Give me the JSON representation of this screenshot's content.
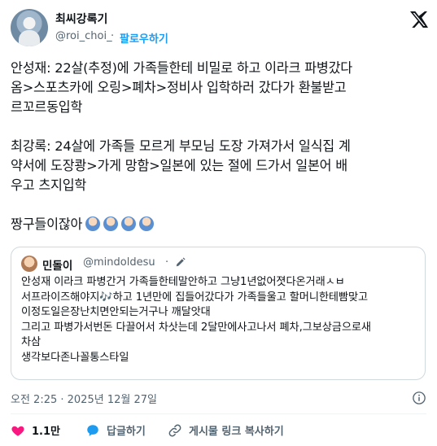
{
  "author": {
    "name": "최씨강록기",
    "handle": "@roi_choi_",
    "separator": "·",
    "follow_label": "팔로우하기"
  },
  "tweet": {
    "paragraphs": [
      [
        "안성재: 22살(추정)에 가족들한테 비밀로 하고 이라크 파병갔다",
        "옴>스포츠카에 오링>폐차>정비사 입학하러 갔다가 환불받고",
        "르꼬르동입학"
      ],
      [
        "최강록: 24살에 가족들 모르게 부모님 도장 가져가서 일식집 계",
        "약서에 도장쾅>가게 망함>일본에 있는 절에 드가서 일본어 배",
        "우고 츠지입학"
      ],
      [
        "짱구들이잖아"
      ]
    ],
    "emoji_name": "facepalm-emoji",
    "emoji_count": 4
  },
  "quote": {
    "name": "민돌이",
    "handle": "@mindoldesu",
    "separator": "·",
    "lines": [
      "안성재 이라크 파병간거 가족들한테말안하고 그냥1년없어졋다온거래ㅅㅂ",
      "서프라이즈해야지🎶하고 1년만에 집들어갔다가 가족들울고 할머니한테빰맞고",
      "이정도일은장난치면안되는거구나 깨달앗대",
      "그리고 파병가서번돈 다끌어서 차삿는데 2달만에사고나서 폐차,그보상금으로새",
      "차삼",
      "생각보다존나꼴통스타일"
    ]
  },
  "timestamp": "오전 2:25 · 2025년 12월 27일",
  "actions": {
    "like_count": "1.1만",
    "reply_label": "답글하기",
    "copy_link_label": "게시물 링크 복사하기"
  },
  "colors": {
    "accent": "#1d9bf0",
    "like": "#f91880",
    "secondary_text": "#536471"
  }
}
